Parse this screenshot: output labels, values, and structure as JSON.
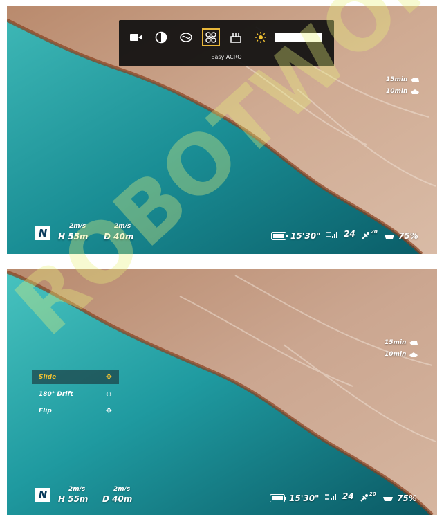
{
  "top_panel": {
    "toolbar": {
      "caption": "Easy ACRO",
      "icons": [
        "video-camera-icon",
        "contrast-icon",
        "panorama-icon",
        "easy-acro-icon",
        "tripod-icon",
        "brightness-icon"
      ],
      "brightness_level": 1.0
    },
    "flight_time": {
      "row1": "15min",
      "row2": "10min"
    },
    "telemetry": {
      "compass": "N",
      "h_speed": "2m/s",
      "h_alt": "H 55m",
      "d_speed": "2m/s",
      "d_dist": "D 40m"
    },
    "status": {
      "timer": "15'30\"",
      "signal": "",
      "satellites": "24",
      "sat_unit": "",
      "gps_num": "20",
      "battery": "75%"
    }
  },
  "bottom_panel": {
    "menu": [
      {
        "label": "Slide",
        "active": true
      },
      {
        "label": "180° Drift",
        "active": false
      },
      {
        "label": "Flip",
        "active": false
      }
    ],
    "flight_time": {
      "row1": "15min",
      "row2": "10min"
    },
    "telemetry": {
      "compass": "N",
      "h_speed": "2m/s",
      "h_alt": "H 55m",
      "d_speed": "2m/s",
      "d_dist": "D 40m"
    },
    "status": {
      "timer": "15'30\"",
      "satellites": "24",
      "gps_num": "20",
      "battery": "75%"
    }
  },
  "watermark": "ROBOTWORLD",
  "colors": {
    "accent_yellow": "#f1c232",
    "water_dark": "#0b6d76",
    "water_light": "#3ab7b4",
    "land": "#c8a58a"
  }
}
